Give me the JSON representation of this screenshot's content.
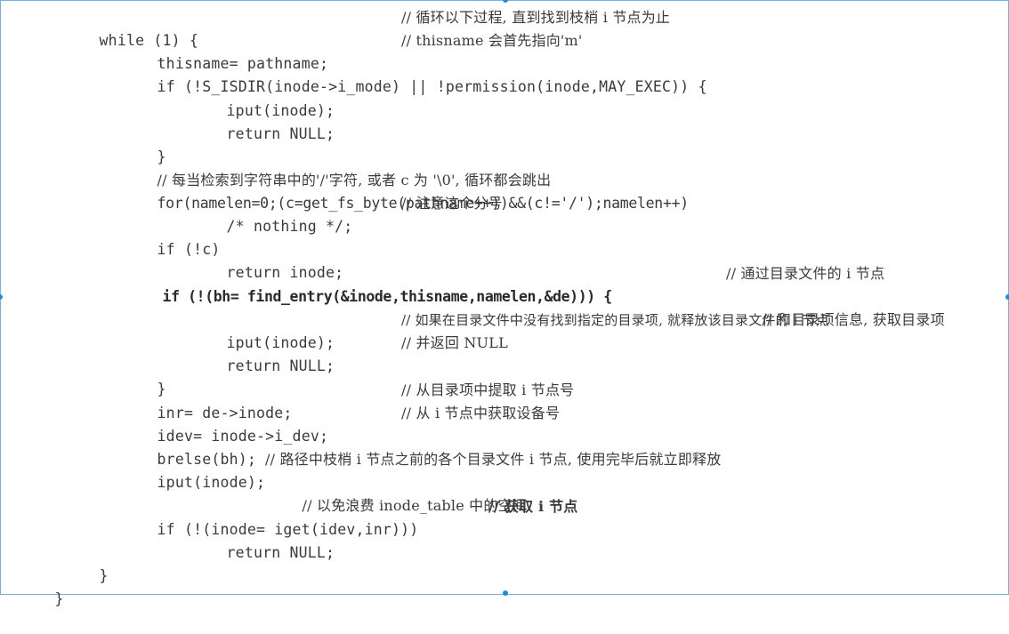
{
  "lines": [
    {
      "code": "while (1) {",
      "comment": "// 循环以下过程, 直到找到枝梢 i 节点为止"
    },
    {
      "code": "thisname= pathname;",
      "comment": "// thisname 会首先指向'm'"
    },
    {
      "code": "if (!S_ISDIR(inode->i_mode) || !permission(inode,MAY_EXEC)) {",
      "comment": ""
    },
    {
      "code": "iput(inode);",
      "comment": ""
    },
    {
      "code": "return NULL;",
      "comment": ""
    },
    {
      "code": "}",
      "comment": ""
    },
    {
      "code": "",
      "comment": "// 每当检索到字符串中的'/'字符, 或者 c 为 '\\0', 循环都会跳出"
    },
    {
      "code": "for(namelen=0;(c=get_fs_byte(pathname++))&&(c!='/');namelen++)",
      "comment": ""
    },
    {
      "code": "/* nothing */;",
      "comment": "// 注意这个分号"
    },
    {
      "code": "if (!c)",
      "comment": ""
    },
    {
      "code": "return inode;",
      "comment": ""
    },
    {
      "code": "if (!(bh= find_entry(&inode,thisname,namelen,&de))) {",
      "comment": "// 通过目录文件的 i 节点"
    },
    {
      "code": "",
      "comment": "// 和目录项信息, 获取目录项"
    },
    {
      "code": "iput(inode);",
      "comment": "// 如果在目录文件中没有找到指定的目录项, 就释放该目录文件的 i 节点"
    },
    {
      "code": "return NULL;",
      "comment": "// 并返回 NULL"
    },
    {
      "code": "}",
      "comment": ""
    },
    {
      "code": "inr= de->inode;",
      "comment": "// 从目录项中提取 i 节点号"
    },
    {
      "code": "idev= inode->i_dev;",
      "comment": "// 从 i 节点中获取设备号"
    },
    {
      "code": "brelse(bh);",
      "comment": ""
    },
    {
      "code": "iput(inode);",
      "comment": "// 路径中枝梢 i 节点之前的各个目录文件 i 节点, 使用完毕后就立即释放"
    },
    {
      "code": "",
      "comment": "// 以免浪费 inode_table 中的空间"
    },
    {
      "code": "if (!(inode= iget(idev,inr)))",
      "comment": "// 获取 i 节点"
    },
    {
      "code": "return NULL;",
      "comment": ""
    },
    {
      "code": "}",
      "comment": ""
    },
    {
      "code": "}",
      "comment": ""
    }
  ]
}
